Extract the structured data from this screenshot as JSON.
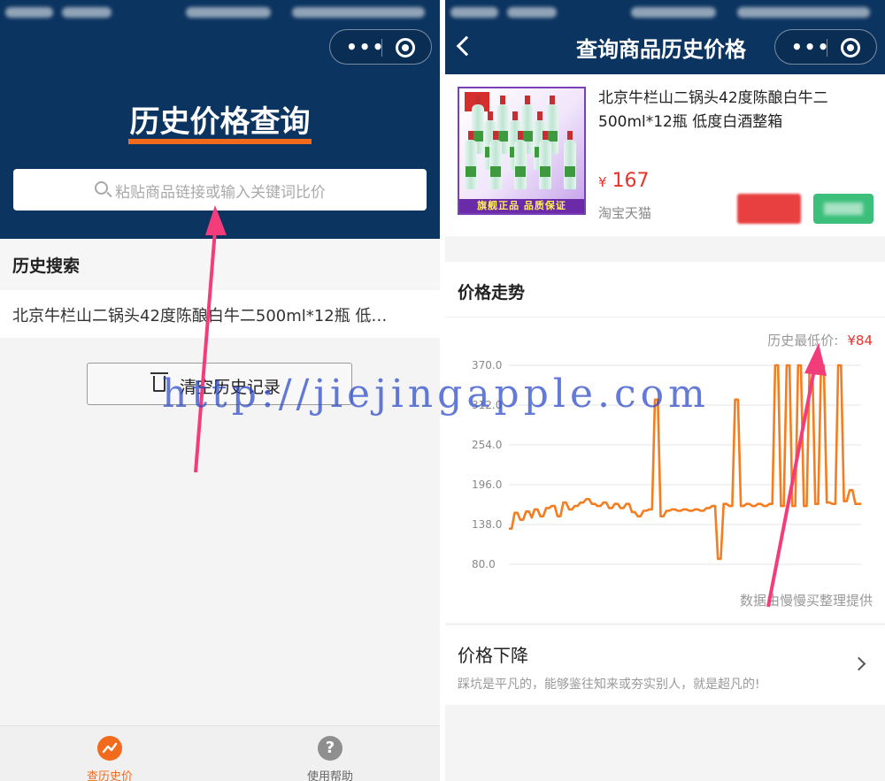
{
  "left": {
    "header_title": "历史价格查询",
    "search_placeholder": "粘贴商品链接或输入关键词比价",
    "history_heading": "历史搜索",
    "history_items": [
      "北京牛栏山二锅头42度陈酿白牛二500ml*12瓶 低…"
    ],
    "clear_label": "清空历史记录",
    "tabs": [
      {
        "label": "查历史价",
        "icon": "trend-icon",
        "active": true,
        "color": "#f26b1d"
      },
      {
        "label": "使用帮助",
        "icon": "help-icon",
        "active": false,
        "color": "#666666",
        "glyph": "?"
      }
    ]
  },
  "right": {
    "page_title": "查询商品历史价格",
    "product": {
      "title": "北京牛栏山二锅头42度陈酿白牛二500ml*12瓶 低度白酒整箱",
      "currency": "¥",
      "price": "167",
      "shop": "淘宝天猫",
      "image_banner": "旗舰正品 品质保证"
    },
    "trend": {
      "heading": "价格走势",
      "lowest_label": "历史最低价:",
      "lowest_value": "¥84",
      "source": "数据由慢慢买整理提供"
    },
    "drop": {
      "title": "价格下降",
      "desc": "踩坑是平凡的，能够鉴往知来或夯实别人，就是超凡的!"
    }
  },
  "overlay": {
    "watermark": "http://jiejingapple.com"
  },
  "colors": {
    "header_bg": "#0c3460",
    "accent": "#f26b1d",
    "price_red": "#e8332b",
    "line": "#f57c1f"
  },
  "chart_data": {
    "type": "line",
    "title": "",
    "xlabel": "",
    "ylabel": "",
    "ylim": [
      80,
      370
    ],
    "yticks": [
      "370.0",
      "312.0",
      "254.0",
      "196.0",
      "138.0",
      "80.0"
    ],
    "series": [
      {
        "values": [
          132,
          132,
          155,
          155,
          145,
          145,
          157,
          157,
          148,
          160,
          160,
          150,
          150,
          162,
          162,
          165,
          165,
          150,
          150,
          170,
          170,
          160,
          160,
          165,
          165,
          170,
          170,
          175,
          175,
          168,
          168,
          165,
          165,
          170,
          170,
          162,
          162,
          168,
          168,
          162,
          162,
          168,
          168,
          156,
          156,
          150,
          150,
          158,
          158,
          160,
          160,
          320,
          320,
          150,
          150,
          158,
          158,
          160,
          160,
          158,
          158,
          160,
          160,
          158,
          158,
          160,
          160,
          158,
          158,
          162,
          162,
          165,
          165,
          88,
          88,
          168,
          168,
          165,
          165,
          320,
          320,
          165,
          165,
          168,
          168,
          165,
          165,
          168,
          168,
          165,
          165,
          168,
          168,
          370,
          370,
          165,
          165,
          370,
          370,
          165,
          165,
          370,
          370,
          165,
          165,
          370,
          370,
          168,
          168,
          370,
          370,
          170,
          170,
          168,
          168,
          370,
          370,
          172,
          172,
          188,
          188,
          168,
          168,
          168
        ]
      }
    ]
  }
}
